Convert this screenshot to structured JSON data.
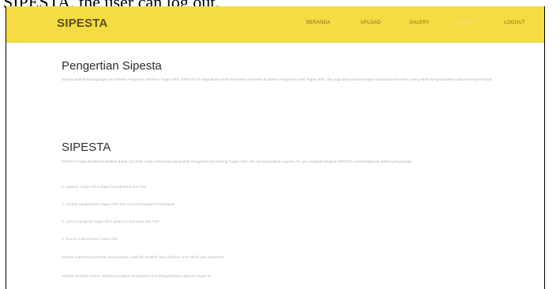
{
  "caption": {
    "text": "SIPESTA, the user can log out."
  },
  "navbar": {
    "brand": "SIPESTA",
    "links": [
      "BERANDA",
      "UPLOAD",
      "GALERY",
      "SITUS",
      "LOGOUT"
    ],
    "active_index": 3,
    "background_color": "#f6dc43"
  },
  "section1": {
    "title": "Pengertian Sipesta",
    "paragraph": "Sipesta adalah kepanjangan dari Sistem Pelaporan Sebelum Tugas Akhir. SIPESTA ini digunakan untuk membantu pemesan di dalam mengakses hasil Tugas Akhir, dan juga diperuntukkan bagi mahasiswa semester 3 yang telah mengumpulkan Laporan Kerja Praktek."
  },
  "section2": {
    "title": "SIPESTA",
    "paragraph": "SIPESTA mulai diimplementasikan Bulan Juli 2020 untuk mahasiswa yang telah mengakomodir tentang Tugas Akhir dan mengumpulkan Laporan TA nya. Langkah-langkah SIPESTA memberlakukan sistem pengupload:",
    "items": [
      "1. Laporan Tugas Akhir dalam bentuk Word dan PDF",
      "2. Lembar pengesahan Tugas Akhir dan Surat keterangan Persetujuan",
      "3. Jurnal mengenai Tugas Akhir dalam bentuk word dan PDF",
      "4. Source kode Project Tugas Akhir",
      "Setelah mahasiswa berhasil mengupload, maka file-terakhir akan diterima oleh Admin dan Supervisor",
      "Setelah diunduh masuk, mahasiswa dapat mengakses form pengunduhan Laporan Tugas TA"
    ]
  }
}
